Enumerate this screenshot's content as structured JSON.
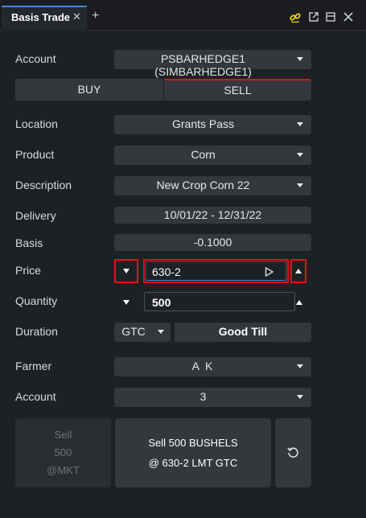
{
  "tab": {
    "title": "Basis Trade",
    "close": "✕",
    "add": "+"
  },
  "form": {
    "account_label": "Account",
    "account_value": "PSBARHEDGE1 (SIMBARHEDGE1)",
    "buy_label": "BUY",
    "sell_label": "SELL",
    "location_label": "Location",
    "location_value": "Grants Pass",
    "product_label": "Product",
    "product_value": "Corn",
    "description_label": "Description",
    "description_value": "New Crop Corn 22",
    "delivery_label": "Delivery",
    "delivery_value": "10/01/22 - 12/31/22",
    "basis_label": "Basis",
    "basis_value": "-0.1000",
    "price_label": "Price",
    "price_value": "630-2",
    "quantity_label": "Quantity",
    "quantity_value": "500",
    "duration_label": "Duration",
    "duration_value": "GTC",
    "good_till_label": "Good Till",
    "farmer_label": "Farmer",
    "farmer_value": "A K",
    "account2_label": "Account",
    "account2_value": "3"
  },
  "actions": {
    "sell_mkt_line1": "Sell",
    "sell_mkt_line2": "500",
    "sell_mkt_line3": "@MKT",
    "sell_lmt_line1": "Sell 500 BUSHELS",
    "sell_lmt_line2": "@ 630-2 LMT GTC"
  },
  "colors": {
    "accent_blue": "#3d8fd8",
    "sell_red": "#e0101a",
    "link_yellow": "#e8d21a"
  }
}
